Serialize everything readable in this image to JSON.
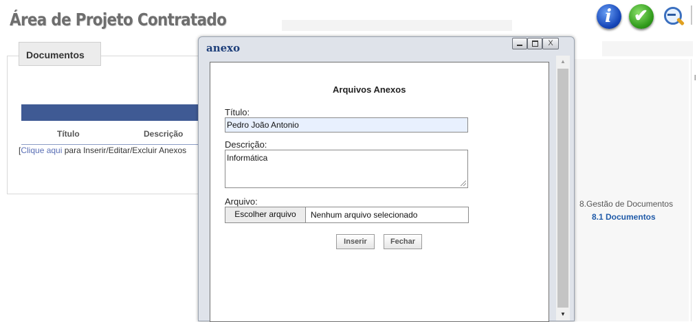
{
  "page": {
    "title": "Área de Projeto Contratado",
    "icons": [
      "info-icon",
      "check-icon",
      "zoom-out-icon"
    ]
  },
  "documents": {
    "section_label": "Documentos",
    "columns": [
      "Título",
      "Descrição"
    ],
    "link_bracket": "[",
    "link_text": "Clique aqui",
    "link_suffix": " para Inserir/Editar/Excluir Anexos"
  },
  "right_nav": {
    "group": "8.Gestão de Documentos",
    "active_item": "8.1 Documentos",
    "edge_text": "l"
  },
  "dialog": {
    "title": "anexo",
    "heading": "Arquivos Anexos",
    "fields": {
      "titulo": {
        "label": "Título:",
        "value": "Pedro João Antonio"
      },
      "descricao": {
        "label": "Descrição:",
        "value": "Informática"
      },
      "arquivo": {
        "label": "Arquivo:",
        "button": "Escolher arquivo",
        "status": "Nenhum arquivo selecionado"
      }
    },
    "buttons": {
      "insert": "Inserir",
      "close": "Fechar"
    },
    "window_controls": {
      "minimize": "_",
      "maximize": "□",
      "close": "X"
    }
  },
  "colors": {
    "table_header": "#3f5a94",
    "dialog_title": "#1e3f7a",
    "nav_link": "#1f5aa8",
    "field_bg": "#e8f0fe"
  }
}
